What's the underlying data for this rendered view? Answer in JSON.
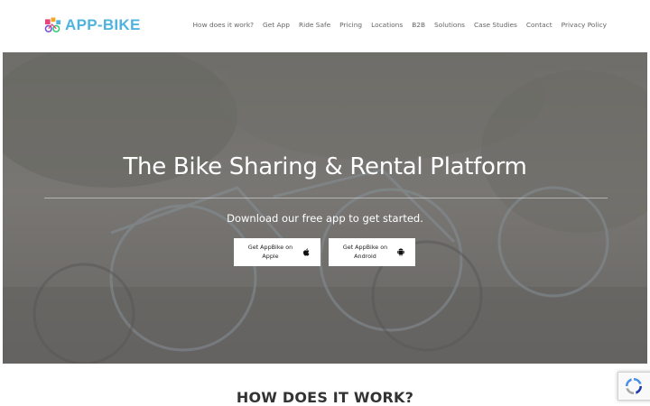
{
  "brand": {
    "name": "APP-BIKE",
    "logo_icon": "bike-share-logo-icon",
    "accent": "#4fb3e0"
  },
  "nav": {
    "items": [
      {
        "label": "How does it work?"
      },
      {
        "label": "Get App"
      },
      {
        "label": "Ride Safe"
      },
      {
        "label": "Pricing"
      },
      {
        "label": "Locations"
      },
      {
        "label": "B2B"
      },
      {
        "label": "Solutions"
      },
      {
        "label": "Case Studies"
      },
      {
        "label": "Contact"
      },
      {
        "label": "Privacy Policy"
      }
    ]
  },
  "hero": {
    "title": "The Bike Sharing & Rental Platform",
    "subtitle": "Download our free app to get started.",
    "apple_button": {
      "label": "Get AppBike on Apple",
      "icon": "apple-icon"
    },
    "android_button": {
      "label": "Get AppBike on Android",
      "icon": "android-icon"
    }
  },
  "section": {
    "title": "HOW DOES IT WORK?"
  },
  "recaptcha": {
    "icon": "recaptcha-icon"
  }
}
